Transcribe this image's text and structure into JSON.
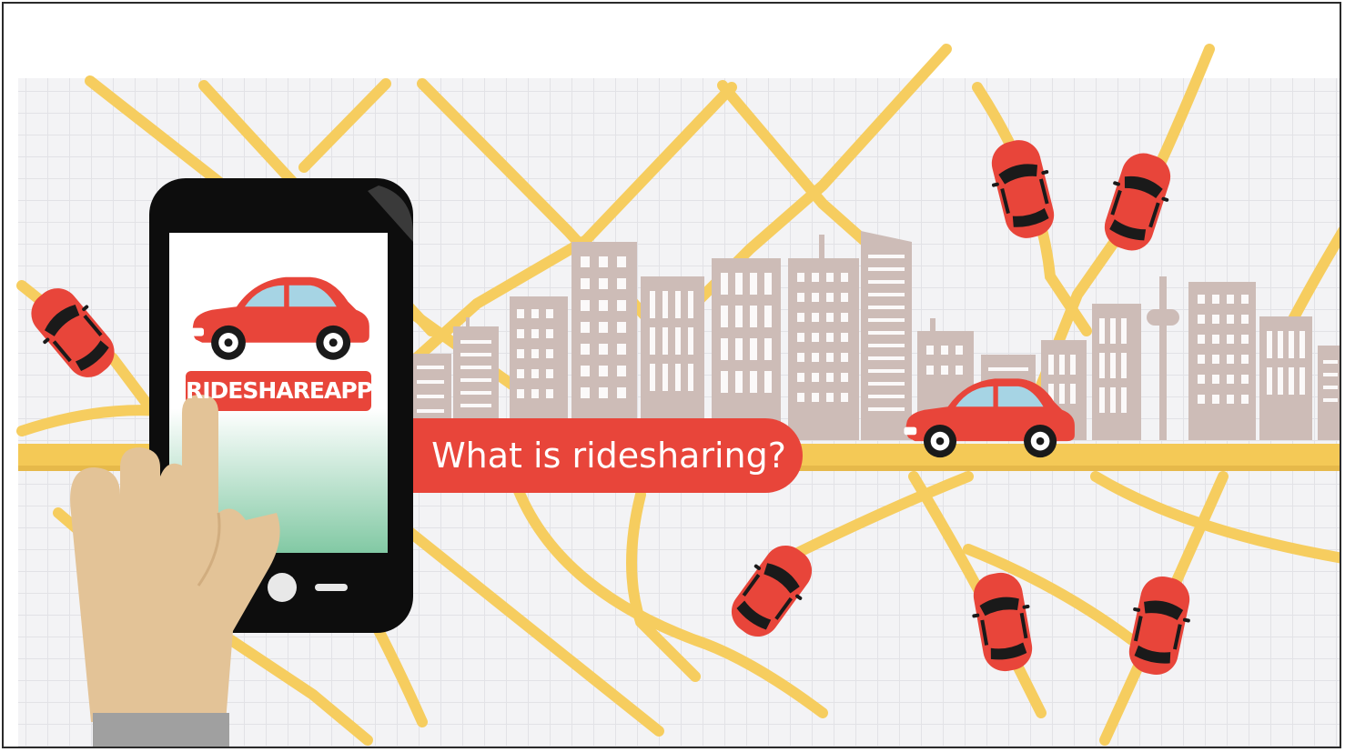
{
  "app_label": "RIDESHAREAPPS",
  "headline": "What is ridesharing?",
  "colors": {
    "accent_red": "#e8453a",
    "road_yellow": "#f6cd5f",
    "building_taupe": "#cdbcb7",
    "grid_bg": "#f1f1f3",
    "phone_black": "#0d0d0d",
    "skin": "#e3c397",
    "cuff_gray": "#a0a0a0",
    "screen_gradient_bottom": "#82c9a4"
  },
  "icons": [
    "smartphone-icon",
    "pointing-hand-icon",
    "car-icon",
    "skyline-illustration",
    "road-map-illustration"
  ]
}
